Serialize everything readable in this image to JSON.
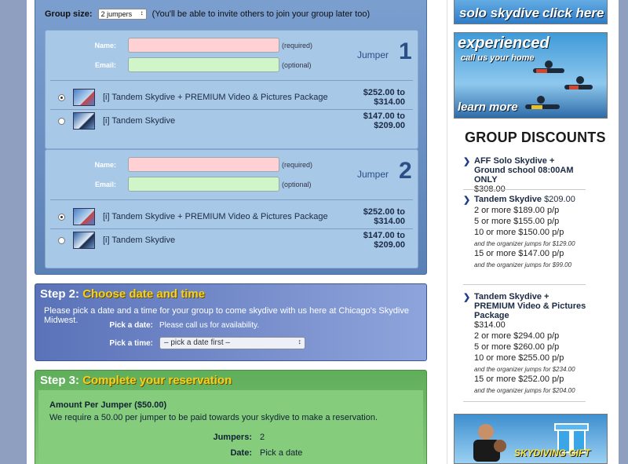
{
  "step1": {
    "group_size_label": "Group size:",
    "group_size_value": "2 jumpers",
    "group_size_hint": "(You'll be able to invite others to join your group later too)",
    "jumpers": [
      {
        "label": "Jumper",
        "number": "1",
        "name_label": "Name:",
        "name_note": "(required)",
        "email_label": "Email:",
        "email_note": "(optional)",
        "packages": [
          {
            "name": "[i] Tandem Skydive + PREMIUM Video & Pictures Package",
            "price": "$252.00 to $314.00",
            "selected": true
          },
          {
            "name": "[i] Tandem Skydive",
            "price": "$147.00 to $209.00",
            "selected": false
          }
        ]
      },
      {
        "label": "Jumper",
        "number": "2",
        "name_label": "Name:",
        "name_note": "(required)",
        "email_label": "Email:",
        "email_note": "(optional)",
        "packages": [
          {
            "name": "[i] Tandem Skydive + PREMIUM Video & Pictures Package",
            "price": "$252.00 to $314.00",
            "selected": true
          },
          {
            "name": "[i] Tandem Skydive",
            "price": "$147.00 to $209.00",
            "selected": false
          }
        ]
      }
    ]
  },
  "step2": {
    "step": "Step 2:",
    "title": "Choose date and time",
    "description": "Please pick a date and a time for your group to come skydive with us here at Chicago's Skydive Midwest.",
    "date_label": "Pick a date:",
    "date_value": "Please call us for availability.",
    "time_label": "Pick a time:",
    "time_value": "– pick a date first –"
  },
  "step3": {
    "step": "Step 3:",
    "title": "Complete your reservation",
    "amount_heading": "Amount Per Jumper ($50.00)",
    "requirement": "We require a 50.00 per jumper to be paid towards your skydive to make a reservation.",
    "jumpers_label": "Jumpers:",
    "jumpers_value": "2",
    "date_label": "Date:",
    "date_value": "Pick a date"
  },
  "sidebar": {
    "banner1_text": "click here",
    "banner1_text2": "solo skydive",
    "banner2_title": "experienced",
    "banner2_sub": "call us your home",
    "banner2_cta": "learn more",
    "banner3_text": "SKYDIVING GIFT",
    "group_discounts_title": "GROUP DISCOUNTS",
    "aff": {
      "head": "AFF Solo Skydive + Ground school 08:00AM ONLY",
      "price": "$308.00"
    },
    "tandem": {
      "head": "Tandem Skydive",
      "price": "$209.00",
      "tiers": [
        "2 or more $189.00 p/p",
        "5 or more $155.00 p/p",
        "10 or more $150.00 p/p"
      ],
      "note1": "and the organizer jumps for $129.00",
      "tier4": "15 or more $147.00 p/p",
      "note2": "and the organizer jumps for $99.00"
    },
    "premium": {
      "head": "Tandem Skydive + PREMIUM Video & Pictures Package",
      "price": "$314.00",
      "tiers": [
        "2 or more $294.00 p/p",
        "5 or more $260.00 p/p",
        "10 or more $255.00 p/p"
      ],
      "note1": "and the organizer jumps for $234.00",
      "tier4": "15 or more $252.00 p/p",
      "note2": "and the organizer jumps for $204.00"
    }
  }
}
